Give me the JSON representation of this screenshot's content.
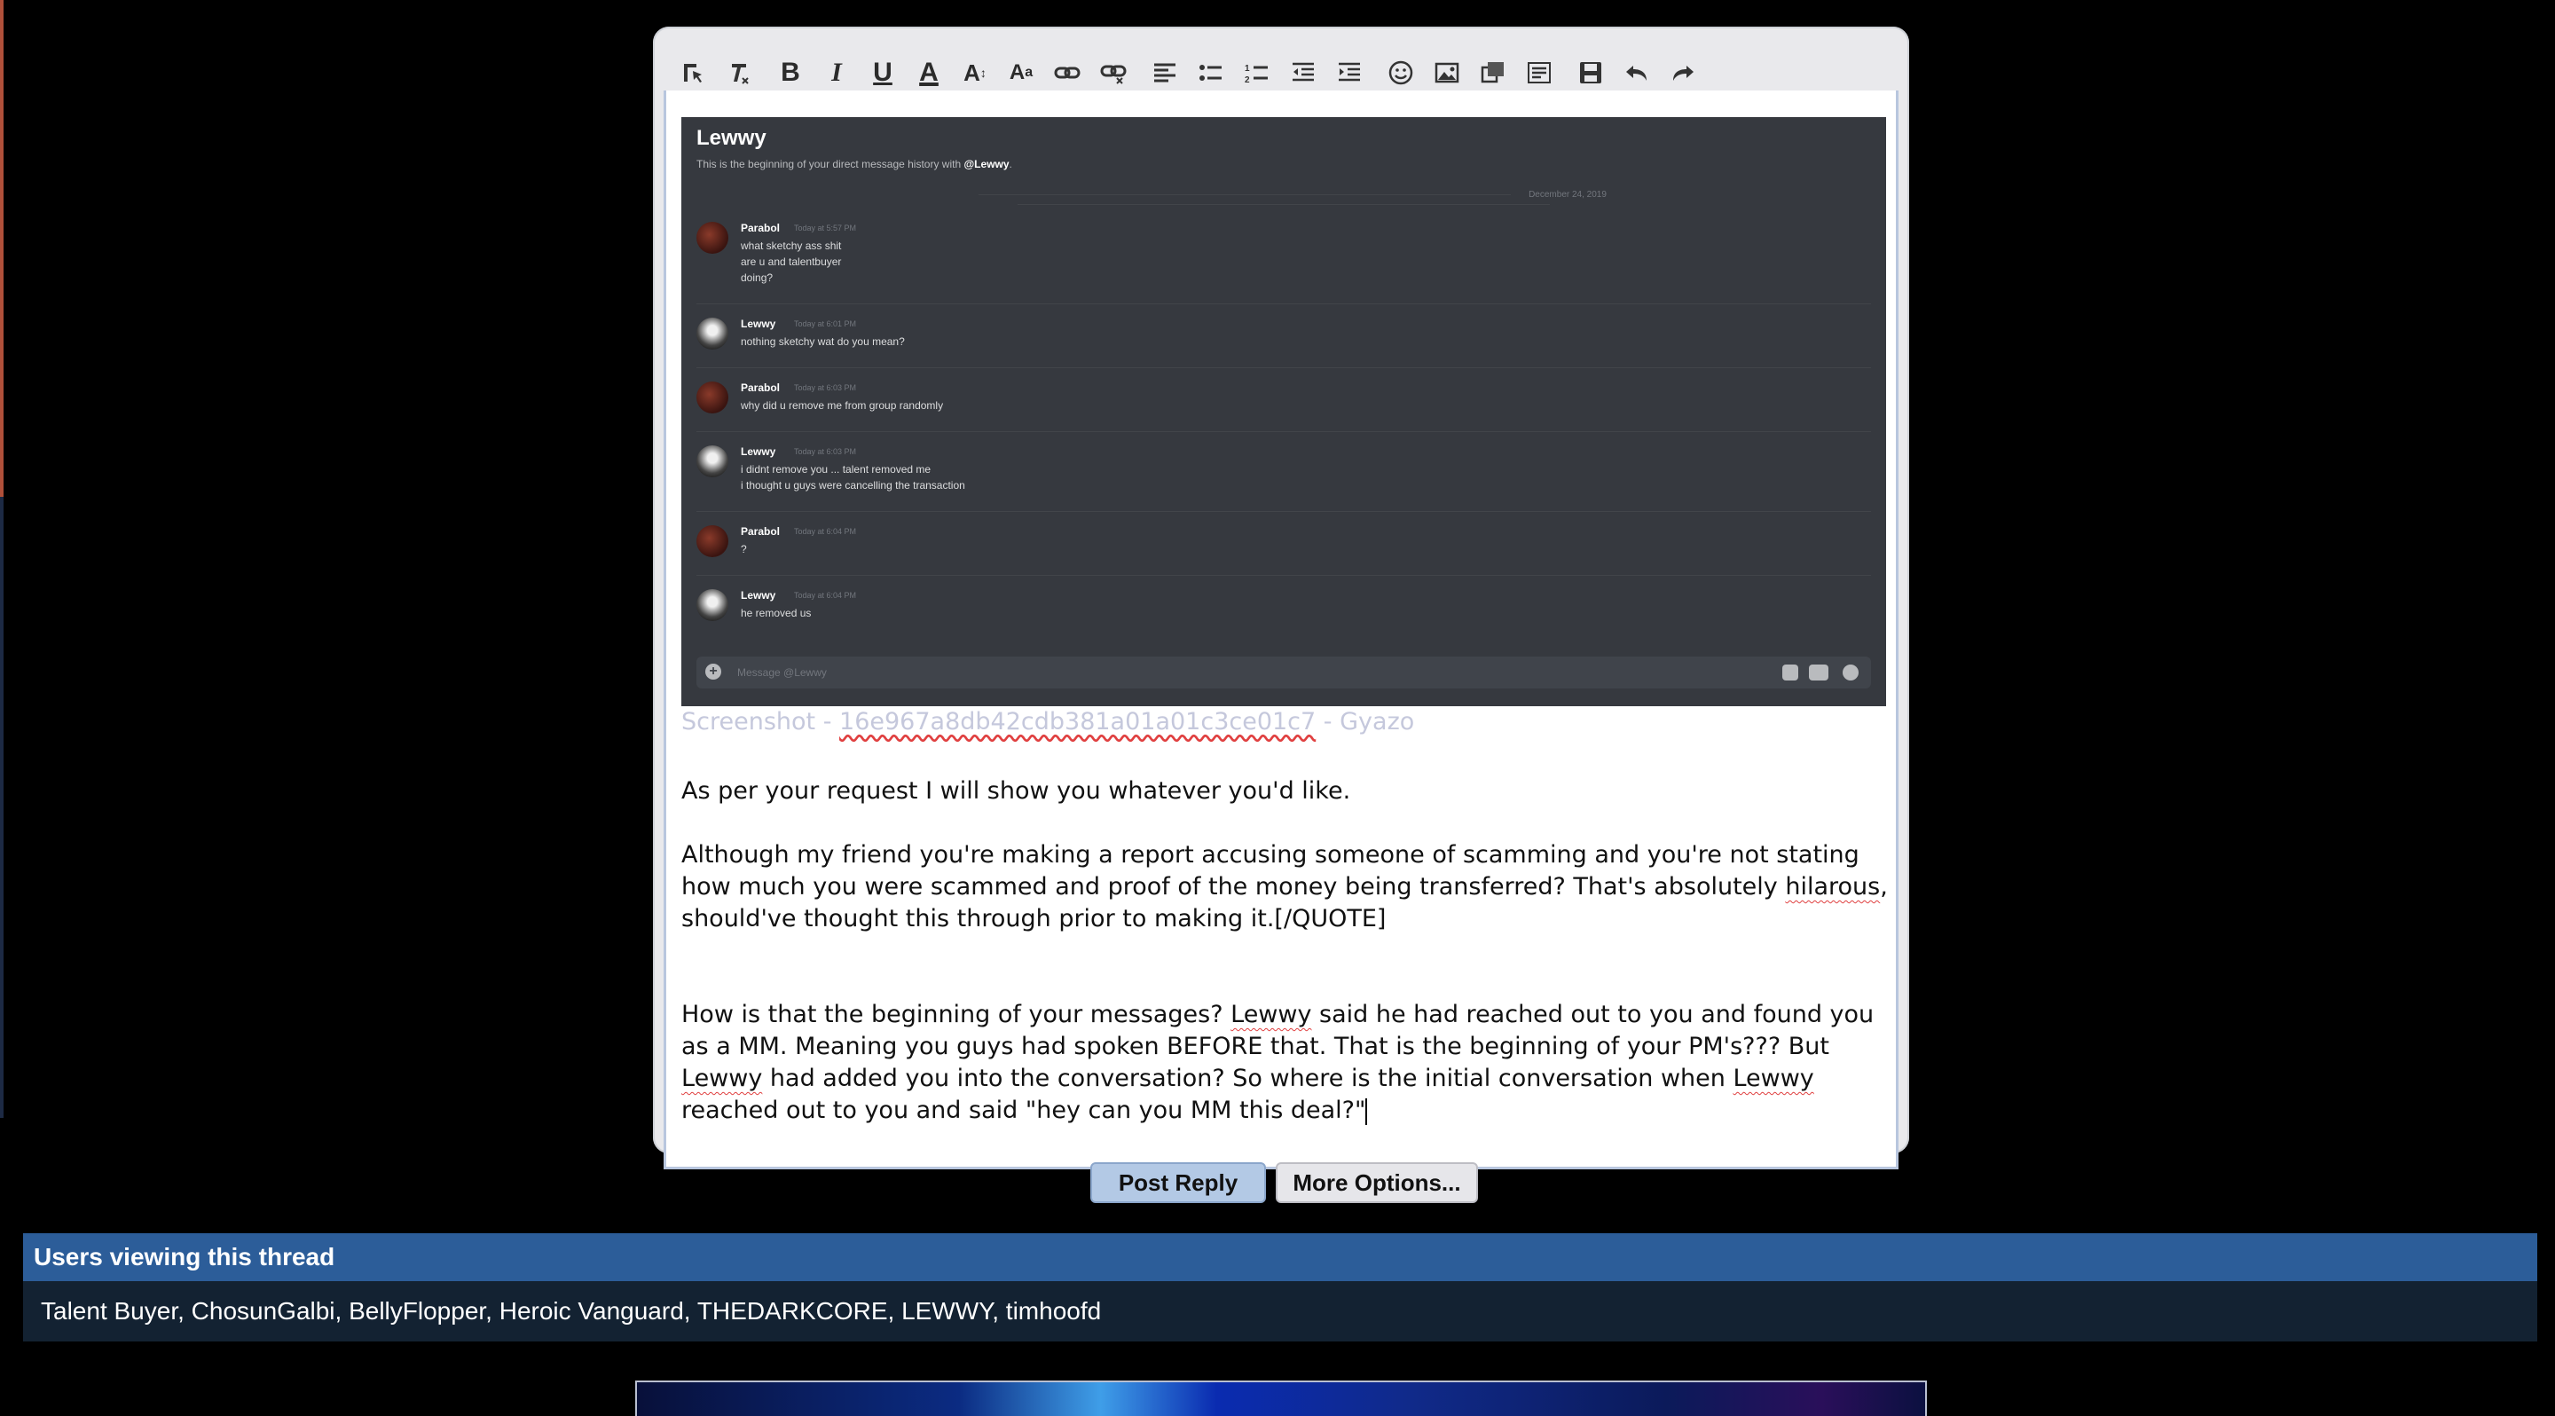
{
  "toolbar": {
    "buttons": [
      "switch-editor-mode",
      "remove-format",
      "bold",
      "italic",
      "underline",
      "font-color",
      "font-size",
      "font",
      "insert-link",
      "unlink",
      "align",
      "bulleted-list",
      "numbered-list",
      "outdent",
      "indent",
      "smilies",
      "insert-image",
      "insert-media",
      "quote",
      "save-draft",
      "undo",
      "redo"
    ]
  },
  "embedded_screenshot": {
    "header_name": "Lewwy",
    "header_sub_prefix": "This is the beginning of your direct message history with ",
    "header_sub_user": "@Lewwy",
    "date_divider": "December 24, 2019",
    "messages": [
      {
        "author": "Parabol",
        "time": "Today at 5:57 PM",
        "text": "what sketchy ass shit\nare u and talentbuyer\ndoing?"
      },
      {
        "author": "Lewwy",
        "time": "Today at 6:01 PM",
        "text": "nothing sketchy wat do you mean?"
      },
      {
        "author": "Parabol",
        "time": "Today at 6:03 PM",
        "text": "why did u remove me from group randomly"
      },
      {
        "author": "Lewwy",
        "time": "Today at 6:03 PM",
        "text": "i didnt remove you ... talent removed me\ni thought u guys were cancelling the transaction"
      },
      {
        "author": "Parabol",
        "time": "Today at 6:04 PM",
        "text": "?"
      },
      {
        "author": "Lewwy",
        "time": "Today at 6:04 PM",
        "text": "he removed us"
      }
    ],
    "input_placeholder": "Message @Lewwy"
  },
  "caption": {
    "prefix": "Screenshot - ",
    "hash": "16e967a8db42cdb381a01a01c3ce01c7",
    "suffix": " - Gyazo"
  },
  "post": {
    "p1": "As per your request I will show you whatever you'd like.",
    "p2a": "Although my friend you're making a report accusing someone of scamming and you're not stating how much you were scammed and proof of the money being transferred? That's absolutely ",
    "p2_spell": "hilarous",
    "p2b": ", should've thought this through prior to making it.[/QUOTE]",
    "p3a": "How is that the beginning of your messages? ",
    "p3_w1": "Lewwy",
    "p3b": " said he had reached out to you and found you as a MM. Meaning you guys had spoken BEFORE that. That is the beginning of your PM's??? But ",
    "p3_w2": "Lewwy",
    "p3c": " had added you into the conversation? So where is the initial conversation when ",
    "p3_w3": "Lewwy",
    "p3d": " reached out to you and said \"hey can you MM this deal?\""
  },
  "buttons": {
    "post_reply": "Post Reply",
    "more_options": "More Options..."
  },
  "viewers": {
    "title": "Users viewing this thread",
    "list": "Talent Buyer, ChosunGalbi, BellyFlopper, Heroic Vanguard, THEDARKCORE, LEWWY, timhoofd"
  },
  "colors": {
    "viewers_header": "#2c5d99",
    "viewers_body": "#132232",
    "post_button": "#b3c9e5"
  }
}
